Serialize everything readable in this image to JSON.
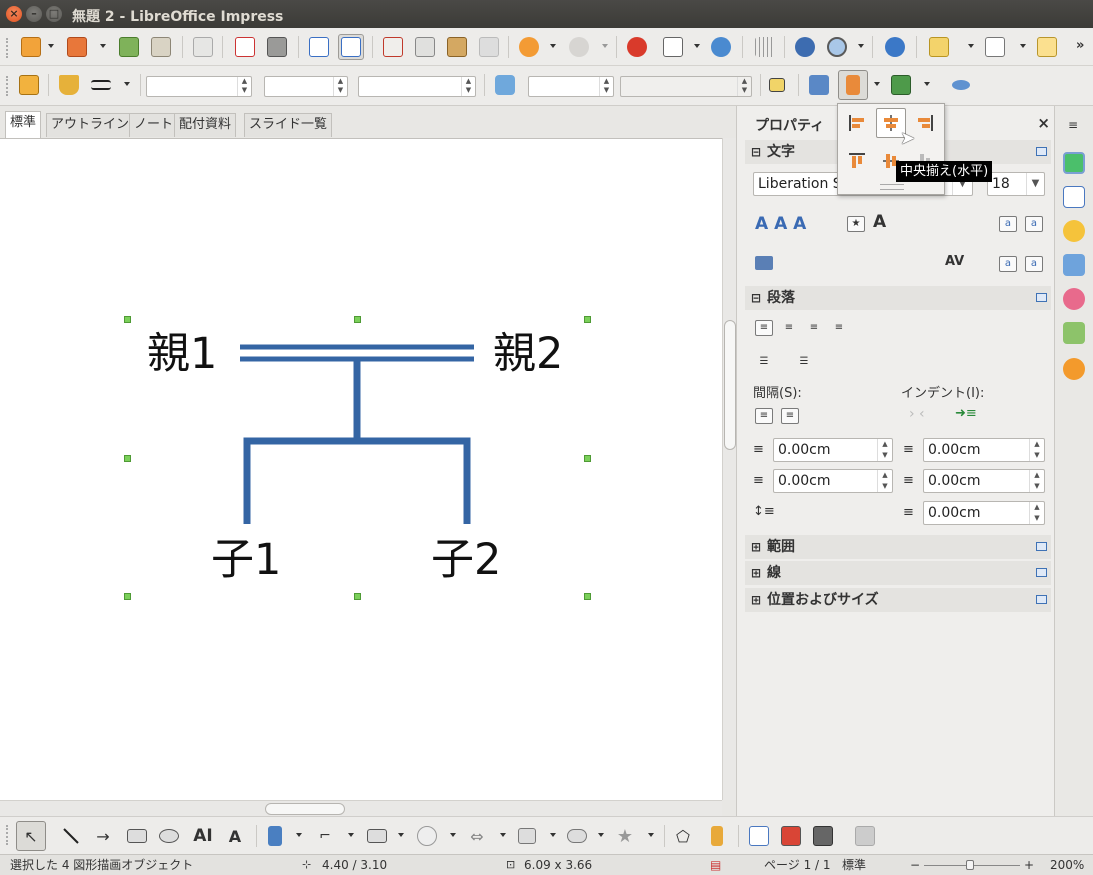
{
  "window": {
    "title": "無題 2 - LibreOffice Impress"
  },
  "view_tabs": [
    "標準",
    "アウトライン",
    "ノート",
    "配付資料",
    "スライド一覧"
  ],
  "slide": {
    "parent1": "親1",
    "parent2": "親2",
    "child1": "子1",
    "child2": "子2",
    "connector_color": "#3465a4"
  },
  "sidebar": {
    "title": "プロパティ",
    "character": {
      "header": "文字",
      "font_name": "Liberation S",
      "font_size": "18"
    },
    "paragraph": {
      "header": "段落",
      "spacing_label": "間隔(S):",
      "indent_label": "インデント(I):",
      "above_spacing": "0.00cm",
      "below_spacing": "0.00cm",
      "before_indent": "0.00cm",
      "after_indent": "0.00cm",
      "first_line_indent": "0.00cm"
    },
    "collapsed_sections": [
      "範囲",
      "線",
      "位置およびサイズ"
    ]
  },
  "popup": {
    "tooltip": "中央揃え(水平)"
  },
  "status": {
    "selection": "選択した 4 図形描画オブジェクト",
    "position": "4.40 / 3.10",
    "size": "6.09 x 3.66",
    "page": "ページ 1 / 1",
    "layout": "標準",
    "zoom": "200%"
  },
  "colors": {
    "accent": "#3465a4",
    "handle": "#7bd05a",
    "title_close": "#e0511f"
  }
}
